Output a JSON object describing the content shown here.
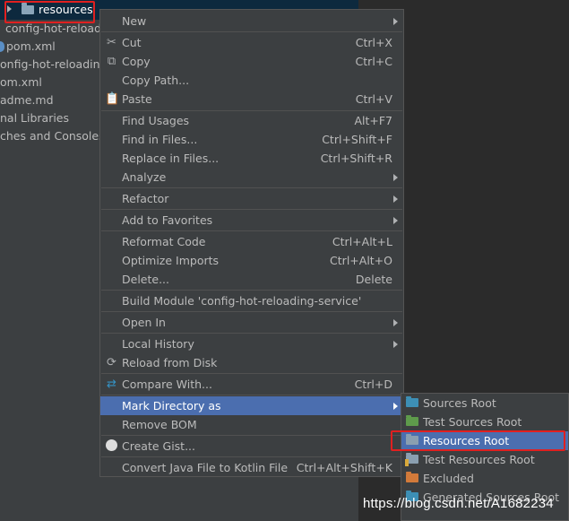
{
  "tree": {
    "selected_folder": "resources",
    "rows": [
      "config-hot-reloadi",
      "pom.xml",
      "onfig-hot-reloading.",
      "om.xml",
      "adme.md",
      "nal Libraries",
      "ches and Consoles"
    ]
  },
  "menu": {
    "new": "New",
    "cut": "Cut",
    "cut_sc": "Ctrl+X",
    "copy": "Copy",
    "copy_sc": "Ctrl+C",
    "copy_path": "Copy Path...",
    "paste": "Paste",
    "paste_sc": "Ctrl+V",
    "find_usages": "Find Usages",
    "find_usages_sc": "Alt+F7",
    "find_in_files": "Find in Files...",
    "find_in_files_sc": "Ctrl+Shift+F",
    "replace_in_files": "Replace in Files...",
    "replace_in_files_sc": "Ctrl+Shift+R",
    "analyze": "Analyze",
    "refactor": "Refactor",
    "add_to_favorites": "Add to Favorites",
    "reformat_code": "Reformat Code",
    "reformat_code_sc": "Ctrl+Alt+L",
    "optimize_imports": "Optimize Imports",
    "optimize_imports_sc": "Ctrl+Alt+O",
    "delete": "Delete...",
    "delete_sc": "Delete",
    "build_module": "Build Module 'config-hot-reloading-service'",
    "open_in": "Open In",
    "local_history": "Local History",
    "reload_from_disk": "Reload from Disk",
    "compare_with": "Compare With...",
    "compare_with_sc": "Ctrl+D",
    "mark_directory_as": "Mark Directory as",
    "remove_bom": "Remove BOM",
    "create_gist": "Create Gist...",
    "convert_java": "Convert Java File to Kotlin File",
    "convert_java_sc": "Ctrl+Alt+Shift+K"
  },
  "submenu": {
    "items": [
      {
        "label": "Sources Root",
        "color": "#3d8fb5"
      },
      {
        "label": "Test Sources Root",
        "color": "#5e9b4b"
      },
      {
        "label": "Resources Root",
        "color": "#8a9fb0"
      },
      {
        "label": "Test Resources Root",
        "color": "#8a9fb0"
      },
      {
        "label": "Excluded",
        "color": "#d27a3a"
      },
      {
        "label": "Generated Sources Root",
        "color": "#3d8fb5"
      }
    ]
  },
  "colors": {
    "menu_bg": "#3c3f41",
    "selection": "#4b6eaf",
    "annotation_red": "#e02020"
  },
  "watermark": "https://blog.csdn.net/A1682234"
}
